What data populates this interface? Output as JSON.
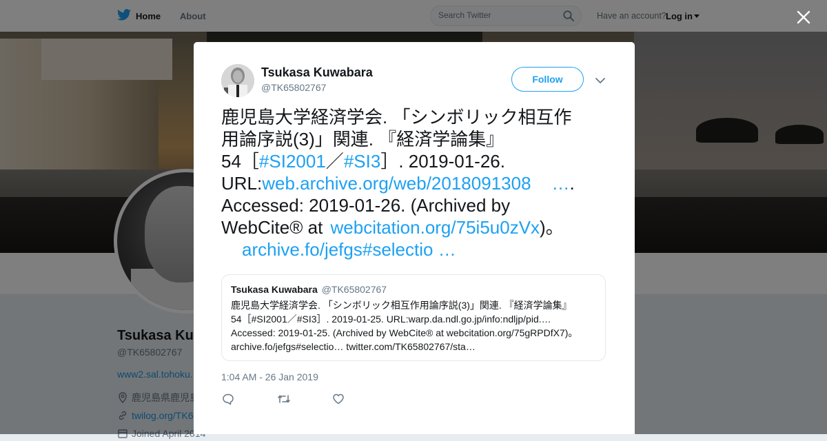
{
  "topbar": {
    "home_label": "Home",
    "about_label": "About",
    "search_placeholder": "Search Twitter",
    "account_prompt": "Have an account?",
    "login_label": "Log in"
  },
  "profile": {
    "name": "Tsukasa Ku",
    "handle": "@TK65802767",
    "url": "www2.sal.tohoku.",
    "location": "鹿児島県鹿児島",
    "link": "twilog.org/TK6",
    "joined": "Joined April 2014"
  },
  "tweet": {
    "author_name": "Tsukasa Kuwabara",
    "author_handle": "@TK65802767",
    "follow_label": "Follow",
    "line1": "鹿児島大学経済学会. 「シンボリック相互作",
    "line2": "用論序説(3)」関連. 『経済学論集』",
    "line3_a": "54［",
    "line3_tag1": "#SI2001",
    "line3_sep": "／",
    "line3_tag2": "#SI3",
    "line3_b": "］. 2019-01-26.",
    "line4_a": "URL:",
    "line4_link": "web.archive.org/web/2018091308",
    "line4_ellipsis": "…",
    "line4_b": ".",
    "line5": "Accessed: 2019-01-26. (Archived by",
    "line6_a": "WebCite® at ",
    "line6_link": "webcitation.org/75i5u0zVx",
    "line6_b": ")。",
    "line7_link": "archive.fo/jefgs#selectio …",
    "timestamp": "1:04 AM - 26 Jan 2019"
  },
  "quoted": {
    "name": "Tsukasa Kuwabara",
    "handle": "@TK65802767",
    "line1": "鹿児島大学経済学会. 「シンボリック相互作用論序説(3)」関連. 『経済学論集』",
    "line2": "54［#SI2001／#SI3］. 2019-01-25.  URL:warp.da.ndl.go.jp/info:ndljp/pid.…",
    "line3": "Accessed: 2019-01-25. (Archived by WebCite® at webcitation.org/75gRPDfX7)。",
    "line4": "archive.fo/jefgs#selectio… twitter.com/TK65802767/sta…"
  },
  "colors": {
    "accent": "#1da1f2",
    "text": "#14171a",
    "muted": "#657786",
    "overlay": "rgba(0,0,0,0.5)"
  },
  "icons": [
    "twitter-bird-icon",
    "search-icon",
    "close-icon",
    "chevron-down-icon",
    "location-icon",
    "link-icon",
    "calendar-icon",
    "reply-icon",
    "retweet-icon",
    "like-icon"
  ]
}
